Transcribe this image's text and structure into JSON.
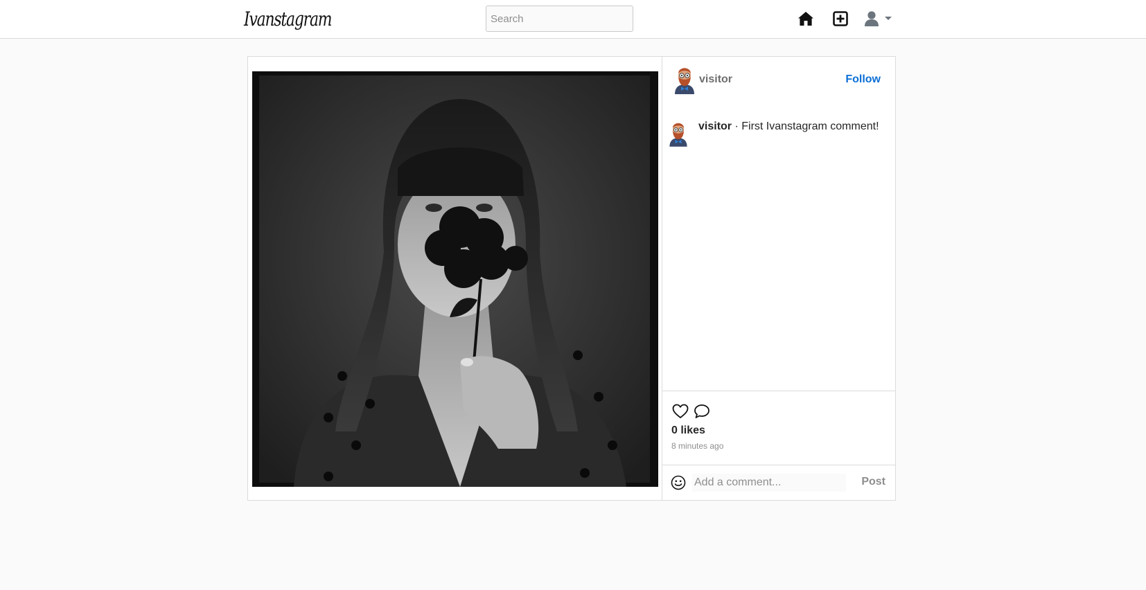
{
  "navbar": {
    "logo": "Ivanstagram",
    "search_placeholder": "Search",
    "icons": [
      "home-icon",
      "add-post-icon",
      "user-icon",
      "caret-down-icon"
    ]
  },
  "post": {
    "author": "visitor",
    "follow_label": "Follow",
    "comments": [
      {
        "user": "visitor",
        "separator": " · ",
        "text": "First Ivanstagram comment!"
      }
    ],
    "likes_text": "0 likes",
    "time_text": "8 minutes ago",
    "comment_placeholder": "Add a comment...",
    "post_label": "Post",
    "action_icons": [
      "heart-icon",
      "comment-bubble-icon",
      "emoji-icon"
    ]
  },
  "colors": {
    "accent": "#0b6fd6",
    "border": "#dbdbdb",
    "background": "#fafafa",
    "muted": "#8e8e8e"
  }
}
